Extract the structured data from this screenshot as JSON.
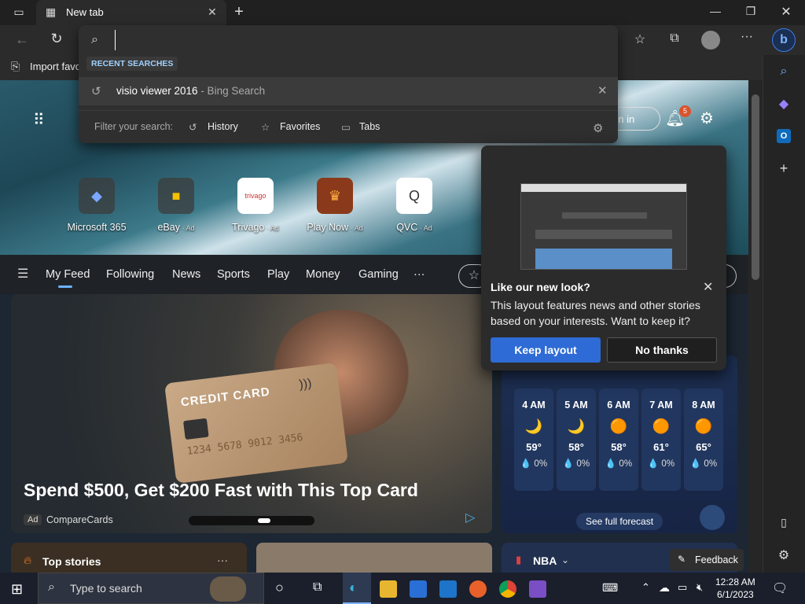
{
  "browser": {
    "tab_title": "New tab",
    "import_favorites": "Import favo",
    "address_value": ""
  },
  "omnibox": {
    "recent_label": "RECENT SEARCHES",
    "recent_query": "visio viewer 2016",
    "recent_source": " - Bing Search",
    "filter_label": "Filter your search:",
    "filters": [
      "History",
      "Favorites",
      "Tabs"
    ]
  },
  "header": {
    "sign_in": "gn in",
    "notification_count": "5"
  },
  "quicklinks": [
    {
      "label": "Microsoft 365",
      "ad": ""
    },
    {
      "label": "eBay",
      "ad": " · Ad"
    },
    {
      "label": "Trivago",
      "ad": " · Ad"
    },
    {
      "label": "Play Now",
      "ad": " · Ad"
    },
    {
      "label": "QVC",
      "ad": " · Ad"
    }
  ],
  "feed_nav": [
    "My Feed",
    "Following",
    "News",
    "Sports",
    "Play",
    "Money",
    "Gaming",
    "···"
  ],
  "big_card": {
    "card_text": "CREDIT CARD",
    "card_number": "1234 5678 9012 3456",
    "title": "Spend $500, Get $200 Fast with This Top Card",
    "ad_badge": "Ad",
    "source": "CompareCards"
  },
  "promo": {
    "title": "Like our new look?",
    "body": "This layout features news and other stories based on your interests. Want to keep it?",
    "keep": "Keep layout",
    "decline": "No thanks"
  },
  "weather": {
    "hours": [
      {
        "time": "4 AM",
        "icon": "🌙",
        "temp": "59°",
        "rain": "💧 0%"
      },
      {
        "time": "5 AM",
        "icon": "🌙",
        "temp": "58°",
        "rain": "💧 0%"
      },
      {
        "time": "6 AM",
        "icon": "🟠",
        "temp": "58°",
        "rain": "💧 0%"
      },
      {
        "time": "7 AM",
        "icon": "🟠",
        "temp": "61°",
        "rain": "💧 0%"
      },
      {
        "time": "8 AM",
        "icon": "🟠",
        "temp": "65°",
        "rain": "💧 0%"
      }
    ],
    "forecast_button": "See full forecast"
  },
  "bottom": {
    "top_stories": "Top stories",
    "more": "···",
    "nba": "NBA",
    "feedback": "Feedback"
  },
  "taskbar": {
    "search_placeholder": "Type to search",
    "time": "12:28 AM",
    "date": "6/1/2023"
  }
}
